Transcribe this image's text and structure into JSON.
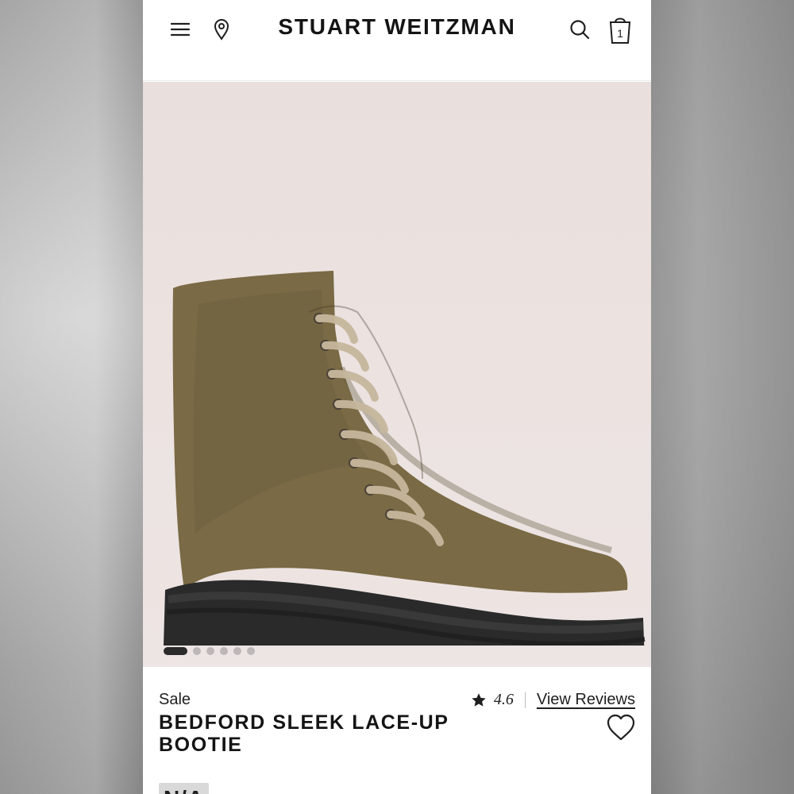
{
  "brand": {
    "name": "STUART WEITZMAN"
  },
  "header": {
    "cart_count": "1",
    "icons": {
      "menu": "menu-icon",
      "location": "location-pin-icon",
      "search": "search-icon",
      "bag": "shopping-bag-icon"
    }
  },
  "gallery": {
    "image_alt": "Boot",
    "dots_total": 6,
    "active_index": 0
  },
  "product": {
    "badge": "Sale",
    "rating": "4.6",
    "reviews_link": "View Reviews",
    "title_line1": "BEDFORD SLEEK LACE-UP",
    "title_line2": "BOOTIE",
    "price_partial": "N/A"
  },
  "colors": {
    "hero_bg": "#ece3e1",
    "boot": "#7a6a45",
    "sole": "#2a2a2a",
    "text": "#141414"
  }
}
